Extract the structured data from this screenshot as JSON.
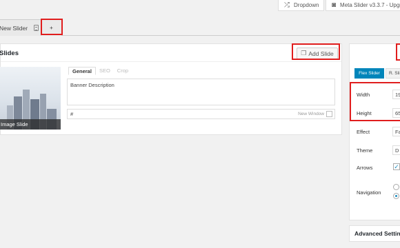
{
  "toolbar": {
    "dropdown_label": "Dropdown",
    "meta_slider_label": "Meta Slider v3.3.7 - Upgr"
  },
  "tabs": {
    "slider_tab_label": "New Slider",
    "add_tab_label": "+"
  },
  "slides_panel": {
    "title": "Slides",
    "add_slide_label": "Add Slide",
    "slide": {
      "type_label": "Image Slide",
      "editor_tabs": [
        "General",
        "SEO",
        "Crop"
      ],
      "description": "Banner Description",
      "url": "#",
      "new_window_label": "New Window"
    }
  },
  "settings_panel": {
    "tabs": [
      "Flex Slider",
      "R. Sli"
    ],
    "fields": {
      "width_label": "Width",
      "width_value": "19",
      "height_label": "Height",
      "height_value": "65",
      "effect_label": "Effect",
      "effect_value": "Fa",
      "theme_label": "Theme",
      "theme_value": "D",
      "arrows_label": "Arrows",
      "navigation_label": "Navigation"
    },
    "advanced_label": "Advanced Setting"
  },
  "colors": {
    "accent": "#0085ba",
    "annotation": "#e01d1d"
  }
}
